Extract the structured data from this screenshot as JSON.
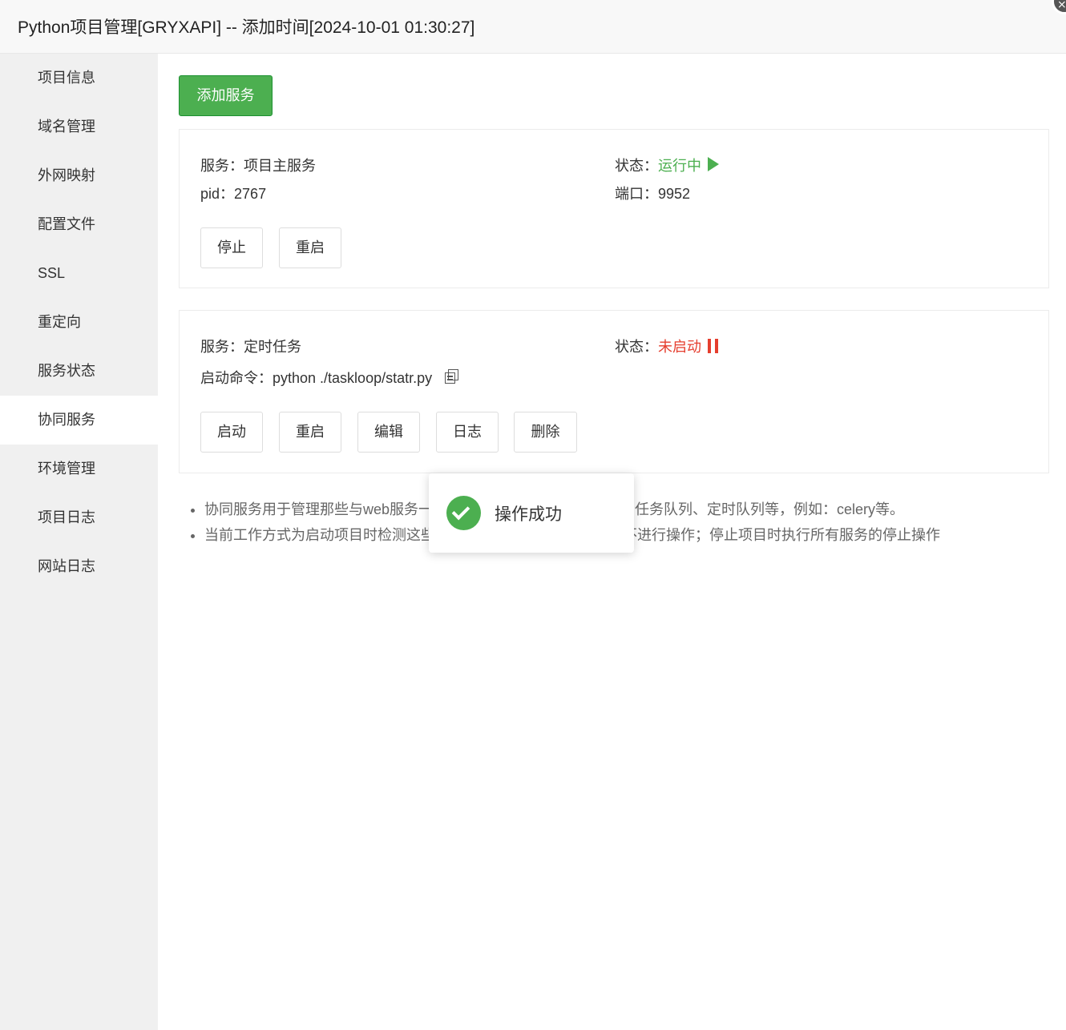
{
  "window": {
    "title": "Python项目管理[GRYXAPI] -- 添加时间[2024-10-01 01:30:27]",
    "close_symbol": "⨯"
  },
  "sidebar": {
    "items": [
      {
        "label": "项目信息"
      },
      {
        "label": "域名管理"
      },
      {
        "label": "外网映射"
      },
      {
        "label": "配置文件"
      },
      {
        "label": "SSL"
      },
      {
        "label": "重定向"
      },
      {
        "label": "服务状态"
      },
      {
        "label": "协同服务"
      },
      {
        "label": "环境管理"
      },
      {
        "label": "项目日志"
      },
      {
        "label": "网站日志"
      }
    ],
    "active": "协同服务"
  },
  "toolbar": {
    "add_service_label": "添加服务"
  },
  "services": [
    {
      "service_label": "服务：",
      "service_name": "项目主服务",
      "status_label": "状态：",
      "status_value": "运行中",
      "status_color": "#4caf50",
      "status_icon": "play-icon",
      "pid_label": "pid：",
      "pid_value": "2767",
      "port_label": "端口：",
      "port_value": "9952",
      "buttons": [
        "停止",
        "重启"
      ]
    },
    {
      "service_label": "服务：",
      "service_name": "定时任务",
      "status_label": "状态：",
      "status_value": "未启动",
      "status_color": "#e53e2e",
      "status_icon": "pause-icon",
      "command_label": "启动命令：",
      "command_value": "python ./taskloop/statr.py",
      "copy_icon": "copy-icon",
      "buttons": [
        "启动",
        "重启",
        "编辑",
        "日志",
        "删除"
      ]
    }
  ],
  "notes": [
    "协同服务用于管理那些与web服务一起启动的附属任务的服务，如：任务队列、定时队列等，例如：celery等。",
    "当前工作方式为启动项目时检测这些服务是否已启动，若已启动则不进行操作；停止项目时执行所有服务的停止操作"
  ],
  "toast": {
    "message": "操作成功",
    "icon": "check-icon",
    "color": "#4caf50"
  }
}
